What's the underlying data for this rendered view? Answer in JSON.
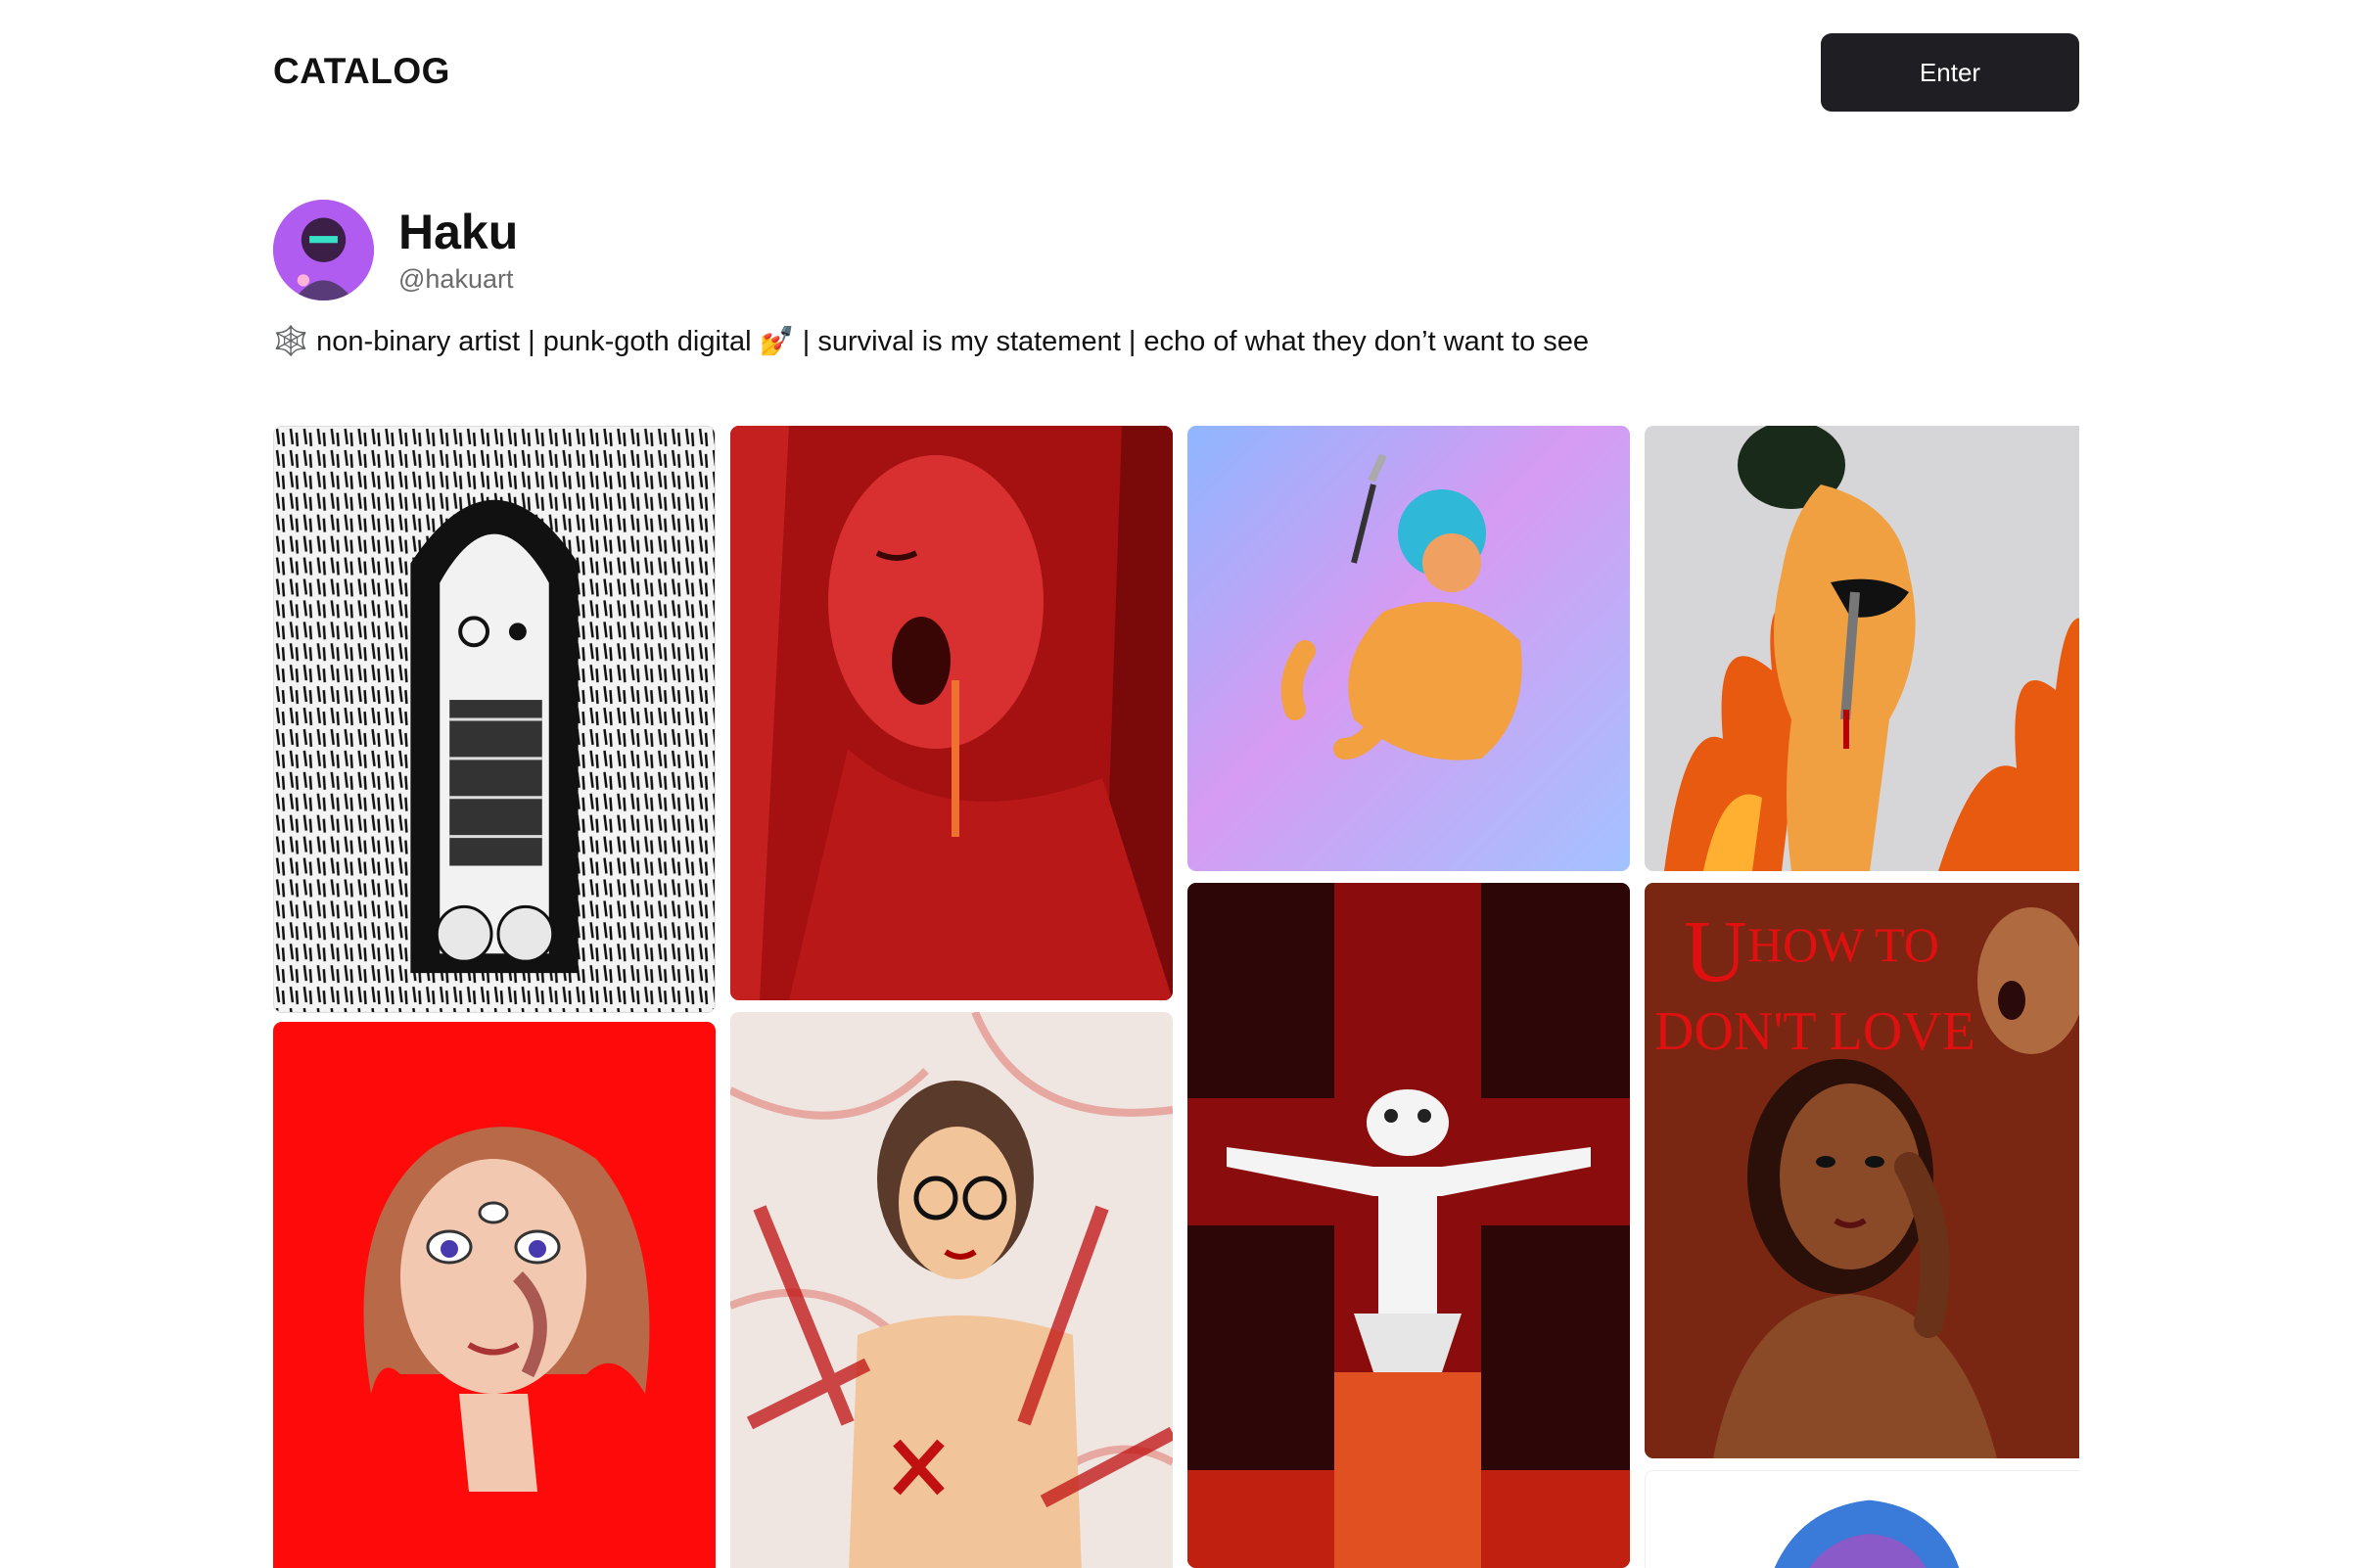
{
  "header": {
    "brand": "CATALOG",
    "enter_label": "Enter"
  },
  "profile": {
    "name": "Haku",
    "handle": "@hakuart",
    "bio": "🕸️ non-binary artist | punk-goth digital 💅 | survival is my statement | echo of what they don’t want to see"
  },
  "gallery": {
    "artworks": [
      {
        "id": "art-1",
        "description": "black and white ink drawing of long-haired ghostly figure"
      },
      {
        "id": "art-2",
        "description": "red painting of screaming bald figure"
      },
      {
        "id": "art-3",
        "description": "pastel figure with blue hair holding a knife"
      },
      {
        "id": "art-4",
        "description": "figure in flames holding a knife"
      },
      {
        "id": "art-5",
        "description": "red portrait with multiple eyes"
      },
      {
        "id": "art-6",
        "description": "figure with glasses and red marks"
      },
      {
        "id": "art-7",
        "description": "white frog figure on red cross"
      },
      {
        "id": "art-8",
        "description": "brown portrait with text",
        "text": [
          "U",
          "HOW TO",
          "DON'T LOVE"
        ]
      },
      {
        "id": "art-9",
        "description": "partial blue-haired figure"
      }
    ]
  },
  "colors": {
    "button_bg": "#1f1f23",
    "text": "#111111",
    "muted": "#6b6b6b"
  }
}
